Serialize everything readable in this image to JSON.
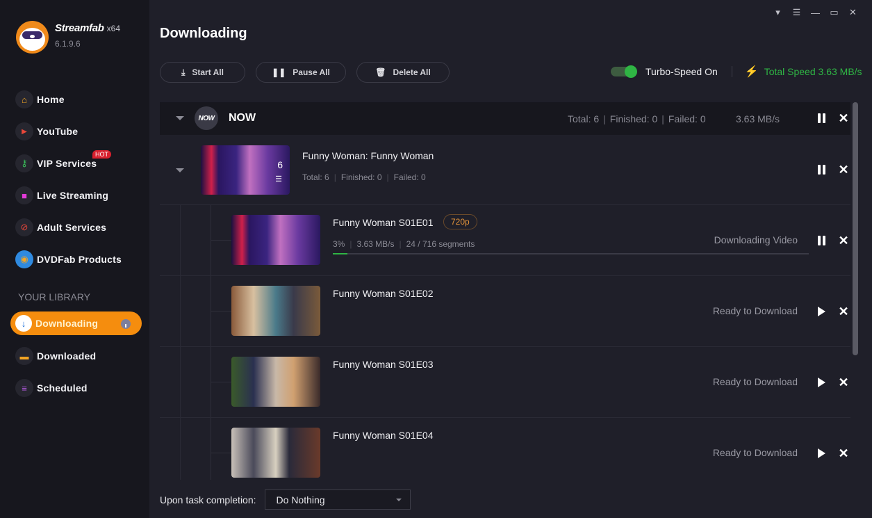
{
  "app": {
    "name": "Streamfab",
    "arch": "x64",
    "version": "6.1.9.6"
  },
  "window_controls": [
    {
      "name": "skin-icon",
      "glyph": "👕"
    },
    {
      "name": "menu-icon",
      "glyph": "☰"
    },
    {
      "name": "minimize-icon",
      "glyph": "—"
    },
    {
      "name": "maximize-icon",
      "glyph": "▭"
    },
    {
      "name": "close-window-icon",
      "glyph": "✕"
    }
  ],
  "sidebar": {
    "items": [
      {
        "label": "Home",
        "icon": "home-icon",
        "glyph": "⌂",
        "color": "#f5a623"
      },
      {
        "label": "YouTube",
        "icon": "youtube-icon",
        "glyph": "▶",
        "color": "#e8473a"
      },
      {
        "label": "VIP Services",
        "icon": "key-icon",
        "glyph": "⚷",
        "color": "#3ac05a",
        "badge": "HOT"
      },
      {
        "label": "Live Streaming",
        "icon": "camera-icon",
        "glyph": "■",
        "color": "#e23ad8"
      },
      {
        "label": "Adult Services",
        "icon": "adult-18-icon",
        "glyph": "⊘",
        "color": "#e8473a"
      },
      {
        "label": "DVDFab Products",
        "icon": "dvdfab-icon",
        "glyph": "◉",
        "color": "#2f8ae0"
      }
    ],
    "library_title": "YOUR LIBRARY",
    "library": [
      {
        "label": "Downloading",
        "icon": "download-icon",
        "glyph": "↓",
        "active": true
      },
      {
        "label": "Downloaded",
        "icon": "folder-icon",
        "glyph": "▬",
        "color": "#f5a623"
      },
      {
        "label": "Scheduled",
        "icon": "clipboard-icon",
        "glyph": "≡",
        "color": "#b45ae0"
      }
    ]
  },
  "header": {
    "title": "Downloading"
  },
  "toolbar": {
    "start_all": "Start All",
    "pause_all": "Pause All",
    "delete_all": "Delete All",
    "turbo_label": "Turbo-Speed On",
    "turbo_on": true,
    "total_speed": "Total Speed 3.63 MB/s"
  },
  "group": {
    "logo_text": "NOW",
    "name": "NOW",
    "total": "Total: 6",
    "finished": "Finished: 0",
    "failed": "Failed: 0",
    "speed": "3.63 MB/s"
  },
  "series": {
    "title": "Funny Woman: Funny Woman",
    "count": "6",
    "total": "Total: 6",
    "finished": "Finished: 0",
    "failed": "Failed: 0"
  },
  "episodes": [
    {
      "title": "Funny Woman S01E01",
      "quality": "720p",
      "percent": "3%",
      "speed": "3.63 MB/s",
      "segments": "24 / 716 segments",
      "progress": 0.03,
      "status": "Downloading Video",
      "state": "downloading"
    },
    {
      "title": "Funny Woman S01E02",
      "status": "Ready to Download",
      "state": "ready"
    },
    {
      "title": "Funny Woman S01E03",
      "status": "Ready to Download",
      "state": "ready"
    },
    {
      "title": "Funny Woman S01E04",
      "status": "Ready to Download",
      "state": "ready"
    }
  ],
  "footer": {
    "label": "Upon task completion:",
    "selected": "Do Nothing"
  },
  "colors": {
    "accent": "#f58d0e",
    "success": "#2fb544",
    "quality": "#e6953a"
  }
}
